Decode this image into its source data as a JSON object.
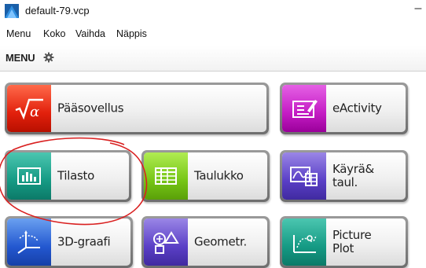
{
  "window": {
    "title": "default-79.vcp",
    "minimize_symbol": "–"
  },
  "menubar": {
    "items": [
      "Menu",
      "Koko",
      "Vaihda",
      "Näppis"
    ]
  },
  "header": {
    "label": "MENU"
  },
  "apps": [
    {
      "label": "Pääsovellus",
      "icon": "sqrt-alpha-icon",
      "color": "#e2200c"
    },
    {
      "label": "eActivity",
      "icon": "eactivity-icon",
      "color": "#c41cc4"
    },
    {
      "label": "Tilasto",
      "icon": "statistics-icon",
      "color": "#159a84"
    },
    {
      "label": "Taulukko",
      "icon": "spreadsheet-icon",
      "color": "#76c516"
    },
    {
      "label": "Käyrä&\ntaul.",
      "icon": "graph-table-icon",
      "color": "#5a3fc6"
    },
    {
      "label": "3D-graafi",
      "icon": "3d-graph-icon",
      "color": "#2358d0"
    },
    {
      "label": "Geometr.",
      "icon": "geometry-icon",
      "color": "#5a3fc6"
    },
    {
      "label": "Picture\nPlot",
      "icon": "picture-plot-icon",
      "color": "#159a84"
    }
  ],
  "annotation": {
    "shape": "hand-drawn circle",
    "color": "#d92020",
    "target": "Tilasto"
  }
}
